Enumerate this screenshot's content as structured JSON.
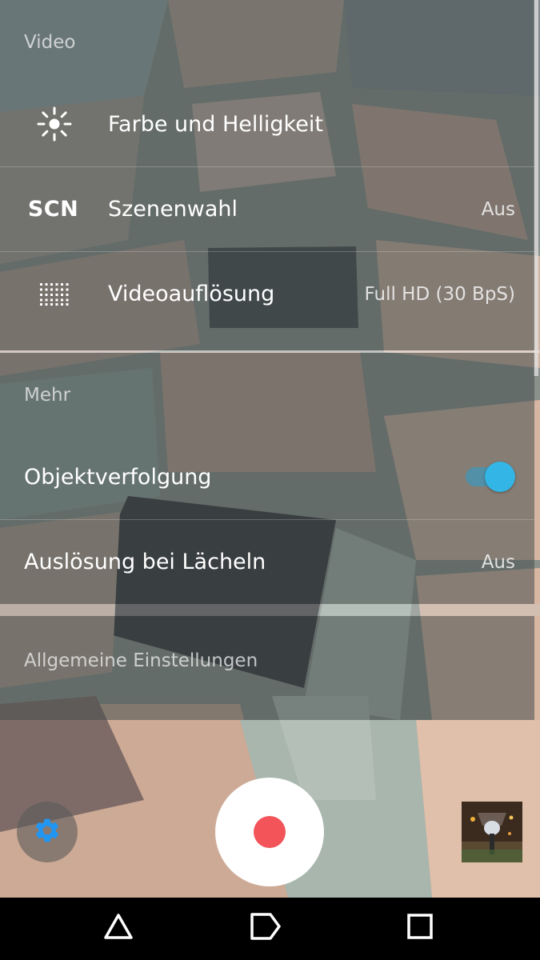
{
  "sections": {
    "video": {
      "header": "Video",
      "rows": [
        {
          "label": "Farbe und Helligkeit",
          "value": ""
        },
        {
          "label": "Szenenwahl",
          "value": "Aus",
          "icon_text": "SCN"
        },
        {
          "label": "Videoauflösung",
          "value": "Full HD (30 BpS)"
        }
      ]
    },
    "more": {
      "header": "Mehr",
      "rows": [
        {
          "label": "Objektverfolgung",
          "toggle_on": true
        },
        {
          "label": "Auslösung bei Lächeln",
          "value": "Aus"
        }
      ]
    },
    "general": {
      "header": "Allgemeine Einstellungen"
    }
  },
  "icons": {
    "brightness": "sun-icon",
    "scene": "scn-icon",
    "resolution": "grid-icon",
    "settings": "gear-icon",
    "record": "record-icon",
    "nav_back": "triangle-back-icon",
    "nav_home": "home-pentagon-icon",
    "nav_recents": "square-recents-icon"
  },
  "colors": {
    "accent": "#33b5e5",
    "record_red": "#f25459",
    "gear_blue": "#2196f3"
  }
}
